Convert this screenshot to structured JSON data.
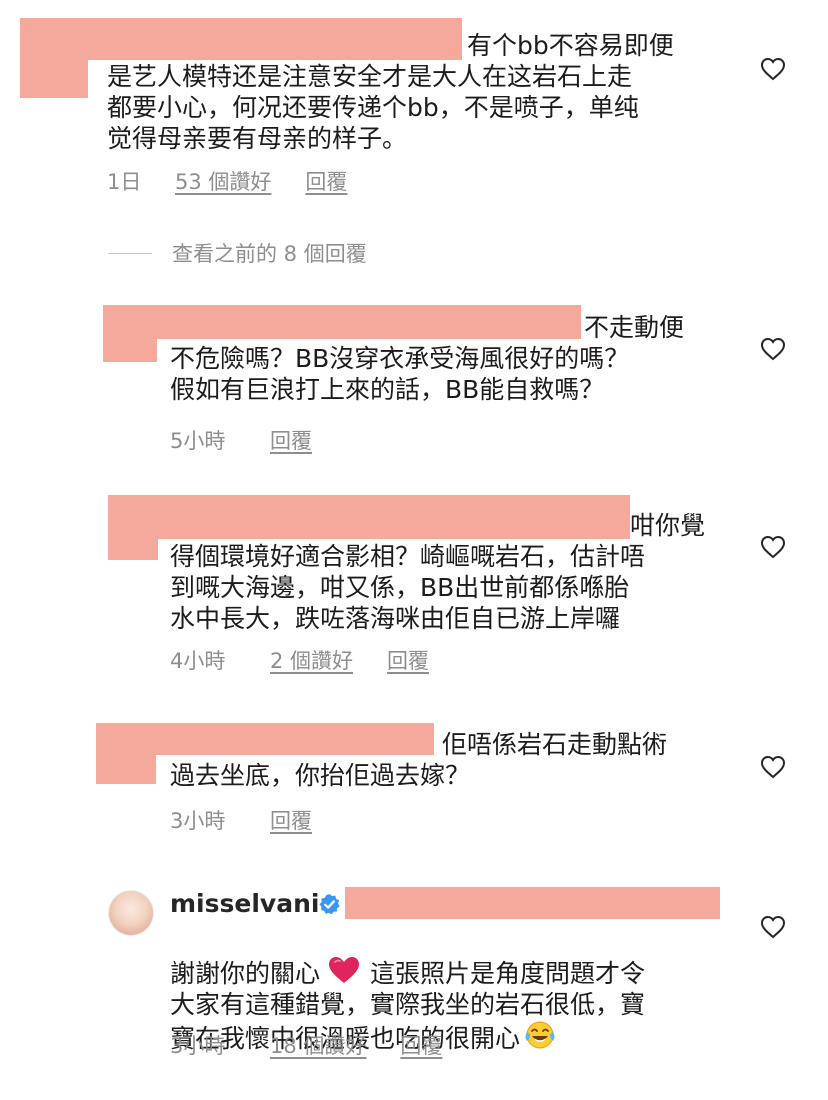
{
  "comments": [
    {
      "text": "有个bb不容易即便\n是艺人模特还是注意安全才是大人在这岩石上走\n都要小心，何况还要传递个bb，不是喷子，单纯\n觉得母亲要有母亲的样子。",
      "time": "1日",
      "likes": "53 個讚好",
      "reply": "回覆"
    },
    {
      "text": "不走動便\n不危險嗎？BB沒穿衣承受海風很好的嗎？\n假如有巨浪打上來的話，BB能自救嗎？",
      "time": "5小時",
      "reply": "回覆"
    },
    {
      "text": "咁你覺\n得個環境好適合影相？崎嶇嘅岩石，估計唔\n到嘅大海邊，咁又係，BB出世前都係喺胎\n水中長大，跌咗落海咪由佢自已游上岸囉",
      "time": "4小時",
      "likes": "2 個讚好",
      "reply": "回覆"
    },
    {
      "text": "佢唔係岩石走動點術\n過去坐底，你抬佢過去嫁？",
      "time": "3小時",
      "reply": "回覆"
    }
  ],
  "view_previous": "查看之前的 8 個回覆",
  "reply_comment": {
    "username": "misselvani",
    "verified": true,
    "text_part1": "謝謝你的關心",
    "text_part2": " 這張照片是角度問題才令\n大家有這種錯覺，實際我坐的岩石很低，寶\n寶在我懷中很溫暖也吃的很開心",
    "time": "3小時",
    "likes": "18 個讚好",
    "reply": "回覆"
  },
  "icons": {
    "like": "heart-outline-icon",
    "verified": "verified-badge-icon",
    "emoji_heart": "red-heart-emoji",
    "emoji_laugh": "tears-of-joy-emoji"
  },
  "colors": {
    "redaction": "#f5a89c",
    "meta_text": "#8e8e8e",
    "verified_blue": "#3897f0",
    "heart_red": "#e0245e"
  }
}
